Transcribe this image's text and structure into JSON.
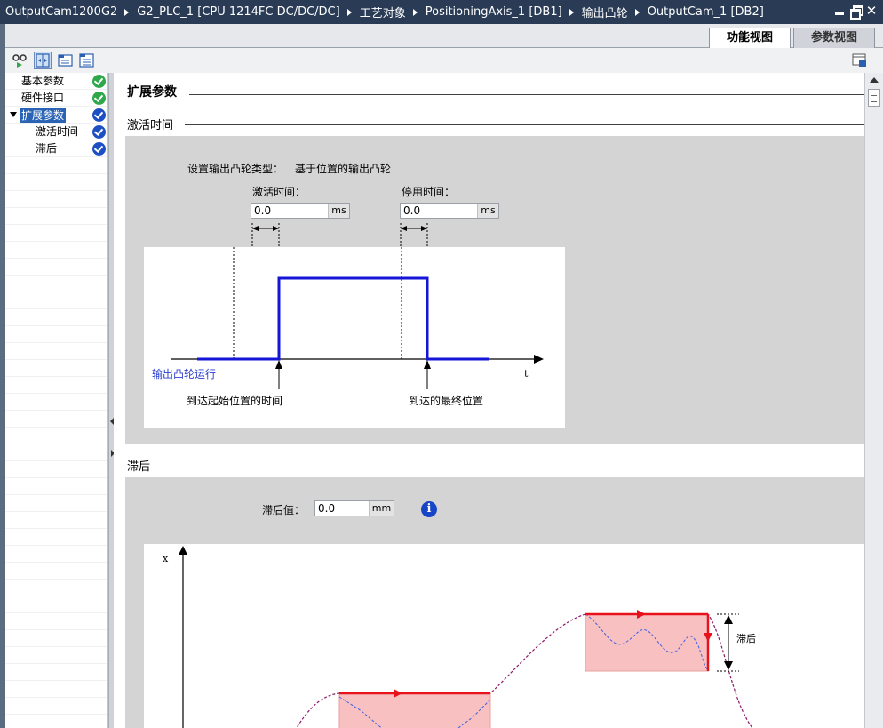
{
  "breadcrumb": [
    "OutputCam1200G2",
    "G2_PLC_1 [CPU 1214FC DC/DC/DC]",
    "工艺对象",
    "PositioningAxis_1 [DB1]",
    "输出凸轮",
    "OutputCam_1 [DB2]"
  ],
  "view_tabs": {
    "function_view": "功能视图",
    "parameter_view": "参数视图"
  },
  "nav": {
    "items": [
      {
        "label": "基本参数",
        "status": "ok"
      },
      {
        "label": "硬件接口",
        "status": "ok"
      },
      {
        "label": "扩展参数",
        "status": "info",
        "selected": true
      },
      {
        "label": "激活时间",
        "status": "info"
      },
      {
        "label": "滞后",
        "status": "info"
      }
    ]
  },
  "content": {
    "page_title": "扩展参数",
    "activation": {
      "section_title": "激活时间",
      "cam_type_label": "设置输出凸轮类型：",
      "cam_type_value": "基于位置的输出凸轮",
      "on_time_label": "激活时间：",
      "on_time_value": "0.0",
      "on_time_unit": "ms",
      "off_time_label": "停用时间：",
      "off_time_value": "0.0",
      "off_time_unit": "ms",
      "diagram": {
        "signal_label": "输出凸轮运行",
        "time_axis_label": "t",
        "start_label": "到达起始位置的时间",
        "end_label": "到达的最终位置"
      }
    },
    "hysteresis": {
      "section_title": "滞后",
      "value_label": "滞后值：",
      "value": "0.0",
      "unit": "mm",
      "info_icon": "i",
      "diagram": {
        "y_axis_label": "x",
        "hysteresis_label": "滞后"
      }
    }
  },
  "colors": {
    "titlebar": "#293b55",
    "signal": "#1515d8",
    "hysteresis": "#e8121c",
    "hysteresis_fill": "#f8c0c0",
    "position_curve": "#8b1a6b"
  }
}
